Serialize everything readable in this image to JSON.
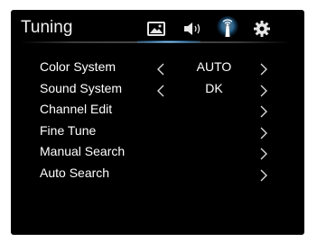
{
  "header": {
    "title": "Tuning",
    "tabs": [
      {
        "name": "picture",
        "icon": "picture-icon",
        "active": false
      },
      {
        "name": "sound",
        "icon": "speaker-icon",
        "active": false
      },
      {
        "name": "channel",
        "icon": "antenna-icon",
        "active": true
      },
      {
        "name": "settings",
        "icon": "gear-icon",
        "active": false
      }
    ],
    "accent_color": "#4ab3ff"
  },
  "menu": {
    "items": [
      {
        "label": "Color System",
        "value": "AUTO",
        "has_left_arrow": true,
        "has_right_arrow": true
      },
      {
        "label": "Sound System",
        "value": "DK",
        "has_left_arrow": true,
        "has_right_arrow": true
      },
      {
        "label": "Channel Edit",
        "value": "",
        "has_left_arrow": false,
        "has_right_arrow": true
      },
      {
        "label": "Fine Tune",
        "value": "",
        "has_left_arrow": false,
        "has_right_arrow": true
      },
      {
        "label": "Manual Search",
        "value": "",
        "has_left_arrow": false,
        "has_right_arrow": true
      },
      {
        "label": "Auto Search",
        "value": "",
        "has_left_arrow": false,
        "has_right_arrow": true
      }
    ]
  }
}
